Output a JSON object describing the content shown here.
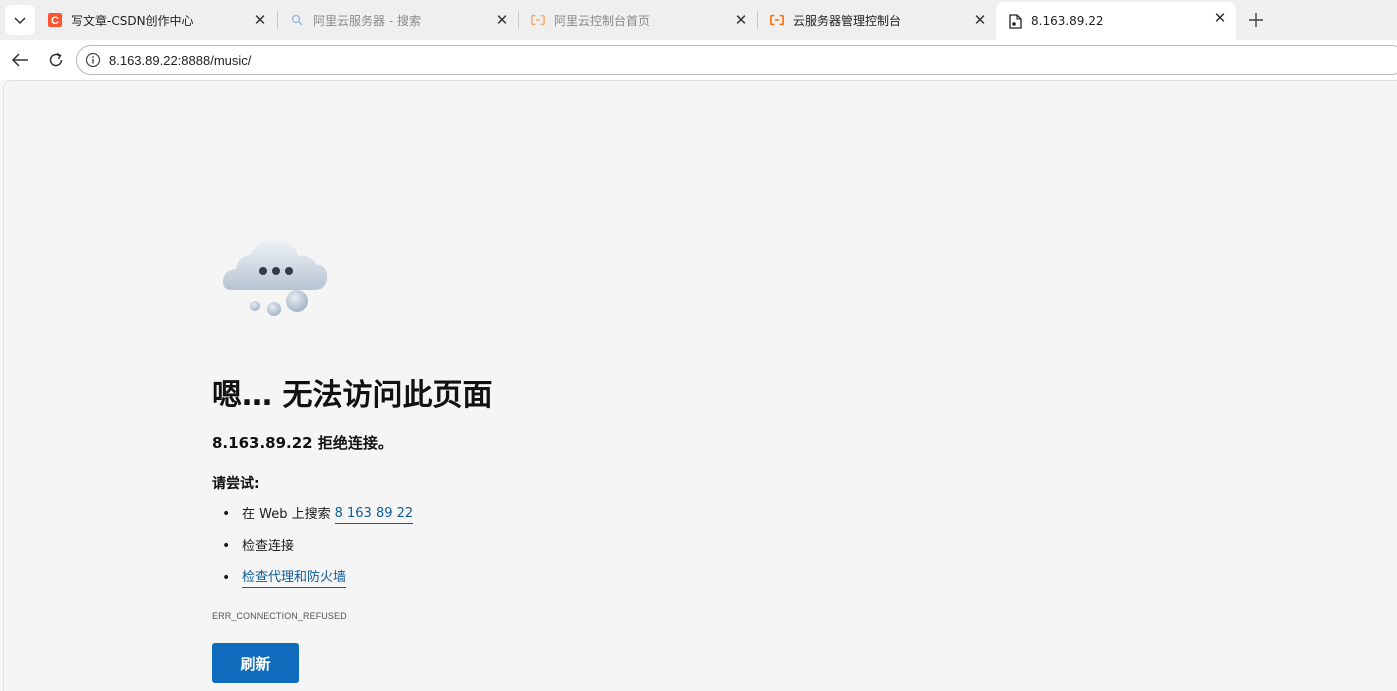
{
  "tabs": [
    {
      "title": "写文章-CSDN创作中心",
      "icon": "csdn-logo-icon",
      "active": false,
      "dim": false
    },
    {
      "title": "阿里云服务器 - 搜索",
      "icon": "search-icon",
      "active": false,
      "dim": true
    },
    {
      "title": "阿里云控制台首页",
      "icon": "aliyun-logo-icon",
      "active": false,
      "dim": true
    },
    {
      "title": "云服务器管理控制台",
      "icon": "aliyun-logo-icon",
      "active": false,
      "dim": false
    },
    {
      "title": "8.163.89.22",
      "icon": "broken-page-icon",
      "active": true,
      "dim": false
    }
  ],
  "address_bar": {
    "url": "8.163.89.22:8888/music/"
  },
  "error_page": {
    "heading": "嗯… 无法访问此页面",
    "subheading": "8.163.89.22 拒绝连接。",
    "try_label": "请尝试:",
    "suggestions": {
      "search_prefix": "在 Web 上搜索 ",
      "search_link": "8 163 89 22",
      "check_connection": "检查连接",
      "check_proxy_link": "检查代理和防火墙"
    },
    "error_code": "ERR_CONNECTION_REFUSED",
    "refresh_button": "刷新"
  },
  "colors": {
    "accent": "#0f6cbd",
    "link": "#0e5c99",
    "csdn": "#fc5531",
    "aliyun": "#ff6a00"
  }
}
